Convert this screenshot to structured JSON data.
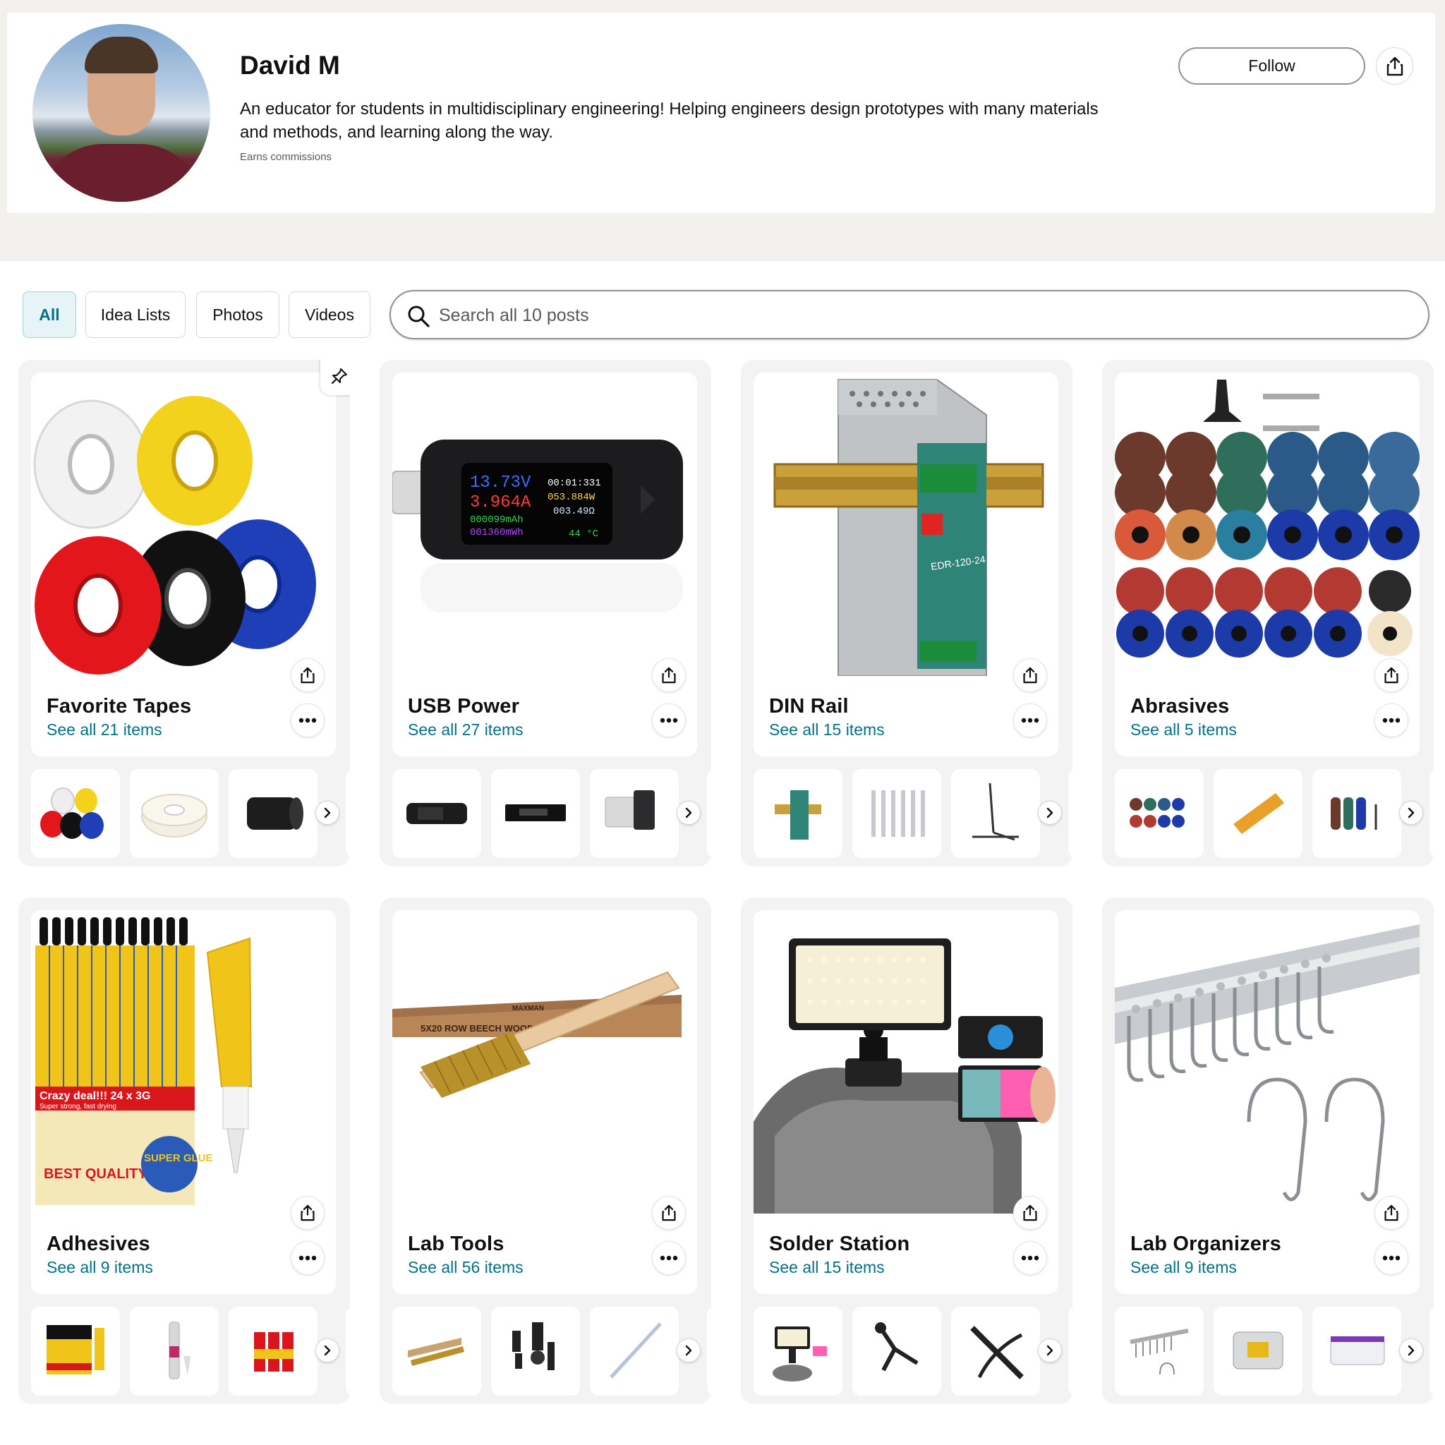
{
  "profile": {
    "name": "David M",
    "bio": "An educator for students in multidisciplinary engineering! Helping engineers design prototypes with many materials and methods, and learning along the way.",
    "note": "Earns commissions",
    "follow_label": "Follow"
  },
  "tabs": [
    {
      "label": "All",
      "active": true
    },
    {
      "label": "Idea Lists",
      "active": false
    },
    {
      "label": "Photos",
      "active": false
    },
    {
      "label": "Videos",
      "active": false
    }
  ],
  "search": {
    "placeholder": "Search all 10 posts"
  },
  "lists": [
    {
      "title": "Favorite Tapes",
      "subtitle": "See all 21 items",
      "pinned": true
    },
    {
      "title": "USB Power",
      "subtitle": "See all 27 items",
      "pinned": false
    },
    {
      "title": "DIN Rail",
      "subtitle": "See all 15 items",
      "pinned": false
    },
    {
      "title": "Abrasives",
      "subtitle": "See all 5 items",
      "pinned": false
    },
    {
      "title": "Adhesives",
      "subtitle": "See all 9 items",
      "pinned": false
    },
    {
      "title": "Lab Tools",
      "subtitle": "See all 56 items",
      "pinned": false
    },
    {
      "title": "Solder Station",
      "subtitle": "See all 15 items",
      "pinned": false
    },
    {
      "title": "Lab Organizers",
      "subtitle": "See all 9 items",
      "pinned": false
    }
  ],
  "product_art": {
    "usb_meter_screen": [
      "13.73V",
      "3.964A",
      "00:01:331",
      "053.884W",
      "003.49Ω",
      "000099mAh",
      "001360mWh",
      "44 °C"
    ],
    "din_rail_label": "EDR-120-24",
    "brush_box_label": "5X20 ROW BEECH WOOD HANDLE",
    "brush_brand": "MAXMAN",
    "glue_banner": "Crazy deal!!! 24 x 3G",
    "glue_sub": "Super strong, fast drying",
    "glue_logo": "SUPER GLUE",
    "glue_quality": "BEST QUALITY"
  },
  "colors": {
    "link": "#007185",
    "tab_active_bg": "#e6f4f7",
    "page_bg": "#f2f1ee"
  },
  "icons": [
    "share-icon",
    "more-icon",
    "pin-icon",
    "search-icon",
    "chevron-right-icon"
  ]
}
